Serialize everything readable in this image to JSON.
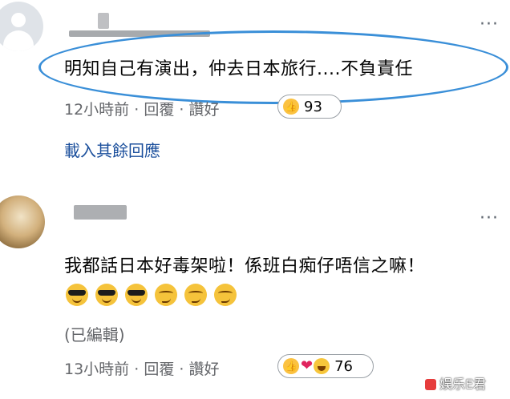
{
  "comments": [
    {
      "text": "明知自己有演出，仲去日本旅行....不負責任",
      "time": "12小時前",
      "reply_label": "回覆",
      "like_label": "讚好",
      "separator": "·",
      "reaction_count": "93",
      "reaction_icons": [
        "like-icon"
      ]
    },
    {
      "text": "我都話日本好毒架啦！係班白痴仔唔信之嘛！",
      "emojis": [
        "sunglasses-emoji",
        "sunglasses-emoji",
        "sunglasses-emoji",
        "smirk-emoji",
        "smirk-emoji",
        "smirk-emoji"
      ],
      "edited_label": "(已編輯)",
      "time": "13小時前",
      "reply_label": "回覆",
      "like_label": "讚好",
      "separator": "·",
      "reaction_count": "76",
      "reaction_icons": [
        "like-icon",
        "heart-icon",
        "haha-icon"
      ]
    }
  ],
  "load_more_label": "載入其餘回應",
  "more_options": "···",
  "watermark": "娱乐E君",
  "highlight_color": "#3a8fd8",
  "link_color": "#1b4f9c"
}
